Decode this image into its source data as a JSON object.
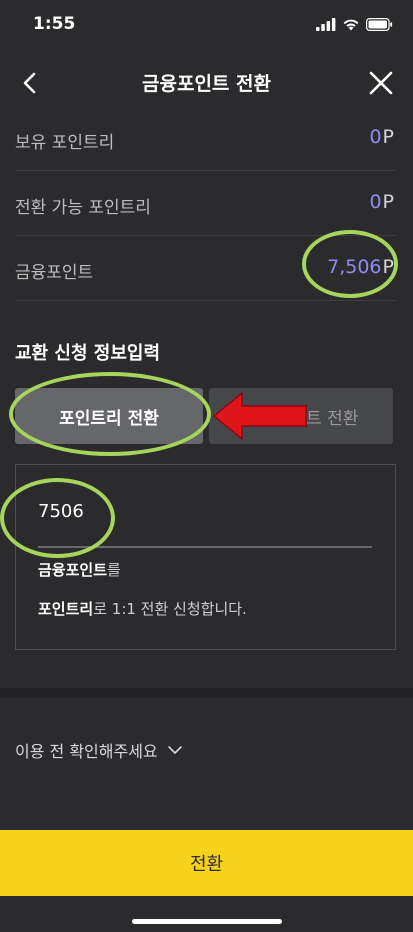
{
  "status_bar": {
    "time": "1:55"
  },
  "header": {
    "title": "금융포인트 전환"
  },
  "balances": [
    {
      "label": "보유 포인트리",
      "value": "0",
      "unit": "P"
    },
    {
      "label": "전환 가능 포인트리",
      "value": "0",
      "unit": "P"
    },
    {
      "label": "금융포인트",
      "value": "7,506",
      "unit": "P"
    }
  ],
  "section": {
    "title": "교환 신청 정보입력"
  },
  "tabs": [
    {
      "label": "포인트리 전환",
      "active": true
    },
    {
      "label": "금융포인트 전환",
      "active": false
    }
  ],
  "form": {
    "amount_value": "7506",
    "line1_bold": "금융포인트",
    "line1_rest": "를",
    "line2_bold": "포인트리",
    "line2_rest": "로 1:1 전환 신청합니다."
  },
  "notice": {
    "label": "이용 전 확인해주세요"
  },
  "cta": {
    "label": "전환"
  },
  "colors": {
    "background": "#2b2b2d",
    "point_value": "#8f8df0",
    "cta": "#f7d21c",
    "annotation_ring": "#a6d45d",
    "annotation_arrow": "#e0141b"
  }
}
